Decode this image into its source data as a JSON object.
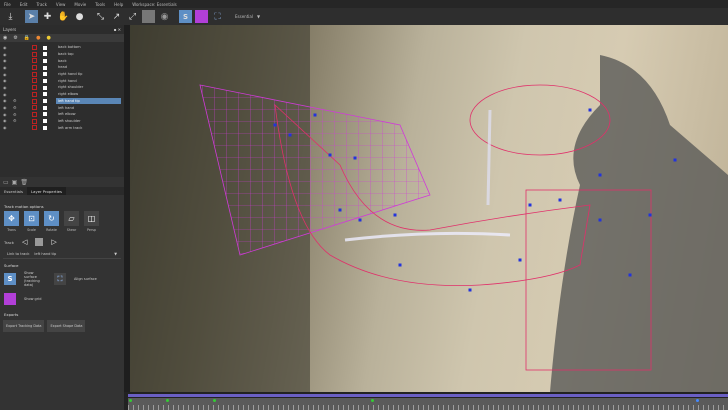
{
  "menu": [
    "File",
    "Edit",
    "Track",
    "View",
    "Movie",
    "Tools",
    "Help",
    "Workspace: Essentials"
  ],
  "toolbar": {
    "workspace_select": "Essential",
    "icons": [
      "import-icon",
      "pointer-icon",
      "add-point-icon",
      "hand-icon",
      "zoom-icon",
      "transform-icon",
      "move-icon",
      "scale-icon",
      "clip-icon",
      "circle-icon",
      "surface-icon",
      "grid-icon",
      "align-icon"
    ]
  },
  "layers": {
    "title": "Layers",
    "items": [
      {
        "name": "back bottom",
        "gear": false
      },
      {
        "name": "back top",
        "gear": false
      },
      {
        "name": "back",
        "gear": false
      },
      {
        "name": "head",
        "gear": false
      },
      {
        "name": "right hand tip",
        "gear": false
      },
      {
        "name": "right hand",
        "gear": false
      },
      {
        "name": "right shoulder",
        "gear": false
      },
      {
        "name": "right elbow",
        "gear": false
      },
      {
        "name": "left hand tip",
        "gear": true,
        "selected": true
      },
      {
        "name": "left hand",
        "gear": true
      },
      {
        "name": "left elbow",
        "gear": true
      },
      {
        "name": "left shoulder",
        "gear": true
      },
      {
        "name": "left arm track",
        "gear": false
      }
    ]
  },
  "tabs": [
    "Essentials",
    "Layer Properties"
  ],
  "track_motion": {
    "title": "Track motion options",
    "options": [
      {
        "label": "Trans",
        "on": true
      },
      {
        "label": "Scale",
        "on": true
      },
      {
        "label": "Rotate",
        "on": true
      },
      {
        "label": "Shear",
        "on": false
      },
      {
        "label": "Persp",
        "on": false
      }
    ]
  },
  "track": {
    "label": "Track"
  },
  "link": {
    "label": "Link to track",
    "value": "left hand tip"
  },
  "surface": {
    "title": "Surface",
    "show_surface": "Show surface (tracking data)",
    "align_surface": "Align surface",
    "show_grid": "Show grid"
  },
  "exports": {
    "title": "Exports",
    "tracking": "Export Tracking Data",
    "shape": "Export Shape Data"
  },
  "colors": {
    "accent": "#5e8fc5",
    "spline": "#e0306a",
    "points": "#2233dd",
    "timeline": "#6a5fc4"
  }
}
